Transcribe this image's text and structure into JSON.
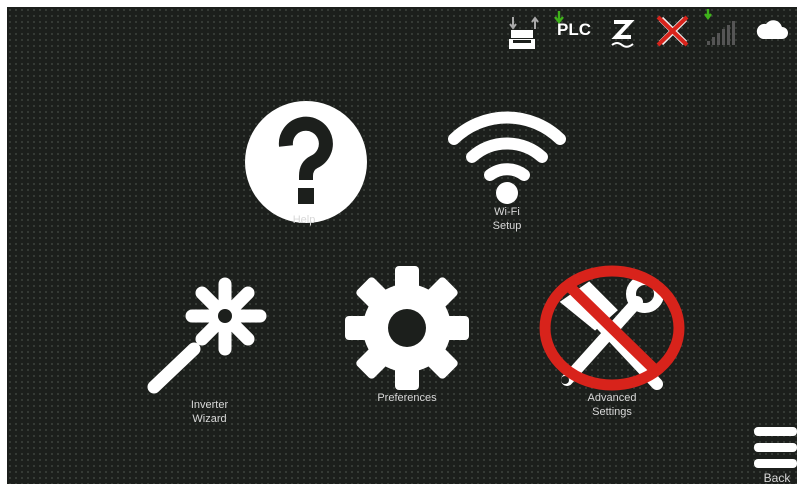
{
  "status_bar": {
    "plc_label": "PLC",
    "icons": [
      "network-transfer-icon",
      "plc-icon",
      "zigbee-icon",
      "disconnected-icon",
      "signal-strength-icon",
      "cloud-icon"
    ]
  },
  "menu": {
    "help": "Help",
    "wifi_line1": "Wi-Fi",
    "wifi_line2": "Setup",
    "inverter_line1": "Inverter",
    "inverter_line2": "Wizard",
    "preferences": "Preferences",
    "advanced_line1": "Advanced",
    "advanced_line2": "Settings"
  },
  "nav": {
    "back_label": "Back"
  },
  "colors": {
    "background": "#1c1f1c",
    "icon": "#ffffff",
    "alert": "#d8231b",
    "indicator_green": "#3fb21b"
  }
}
